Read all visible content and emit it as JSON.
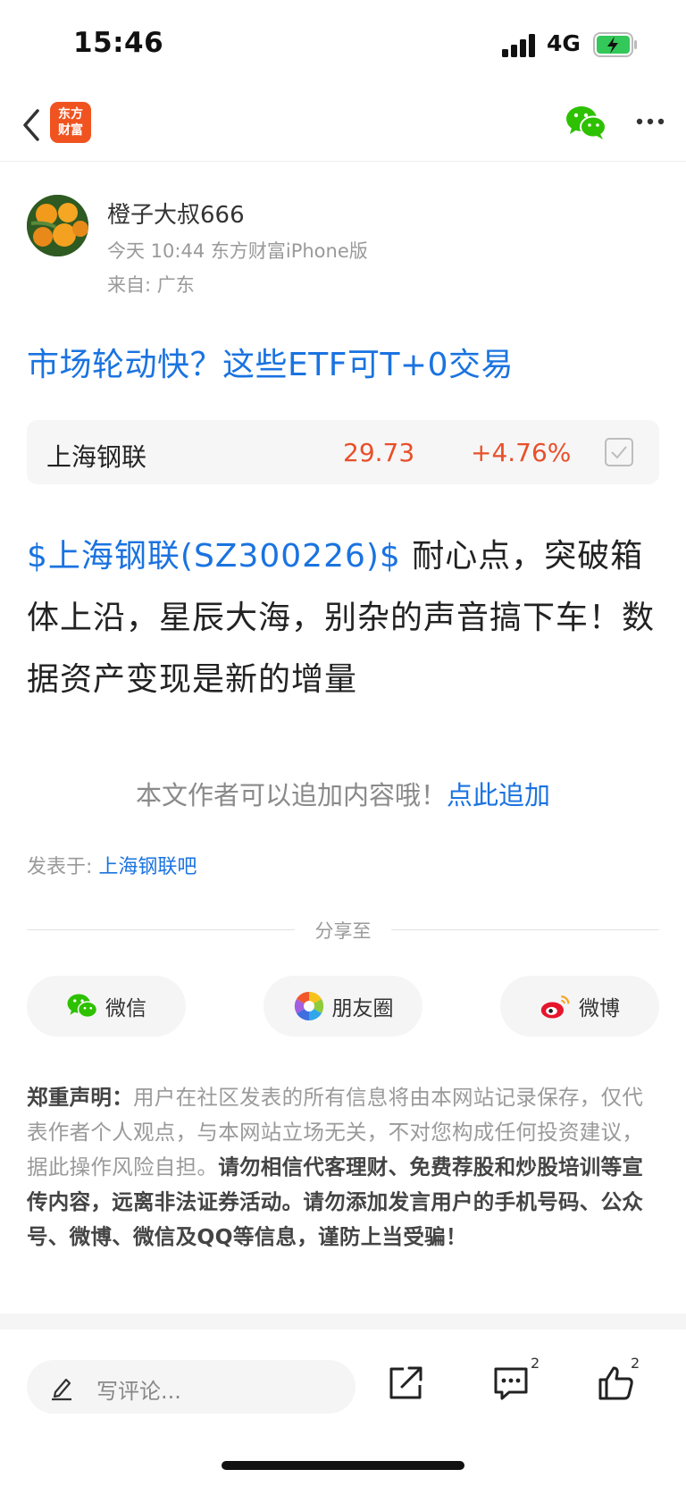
{
  "status_bar": {
    "time": "15:46",
    "network": "4G",
    "battery_charging": true
  },
  "nav": {
    "app_logo_line1": "东方",
    "app_logo_line2": "财富",
    "icons": [
      "chevron-left-icon",
      "wechat-icon",
      "more-icon"
    ]
  },
  "author": {
    "name": "橙子大叔666",
    "meta": "今天 10:44 东方财富iPhone版",
    "location": "来自: 广东"
  },
  "post": {
    "title": "市场轮动快？这些ETF可T+0交易",
    "stock_card": {
      "name": "上海钢联",
      "price": "29.73",
      "change": "+4.76%"
    },
    "body_link": "$上海钢联(SZ300226)$",
    "body_text": " 耐心点，突破箱体上沿，星辰大海，别杂的声音搞下车！数据资产变现是新的增量",
    "append_note": "本文作者可以追加内容哦！",
    "append_link": "点此追加",
    "posted_in_label": "发表于: ",
    "posted_in_bar": "上海钢联吧"
  },
  "share": {
    "label": "分享至",
    "buttons": [
      {
        "label": "微信",
        "icon": "wechat-icon"
      },
      {
        "label": "朋友圈",
        "icon": "moments-icon"
      },
      {
        "label": "微博",
        "icon": "weibo-icon"
      }
    ]
  },
  "disclaimer": {
    "heading": "郑重声明：",
    "normal_text": "用户在社区发表的所有信息将由本网站记录保存，仅代表作者个人观点，与本网站立场无关，不对您构成任何投资建议，据此操作风险自担。",
    "bold_text": "请勿相信代客理财、免费荐股和炒股培训等宣传内容，远离非法证券活动。请勿添加发言用户的手机号码、公众号、微博、微信及QQ等信息，谨防上当受骗！"
  },
  "bottom_bar": {
    "comment_placeholder": "写评论...",
    "comment_count": "2",
    "like_count": "2"
  },
  "colors": {
    "link": "#1a73e0",
    "up": "#e94f2a",
    "brand": "#f0531f",
    "wechat": "#2dc100"
  }
}
